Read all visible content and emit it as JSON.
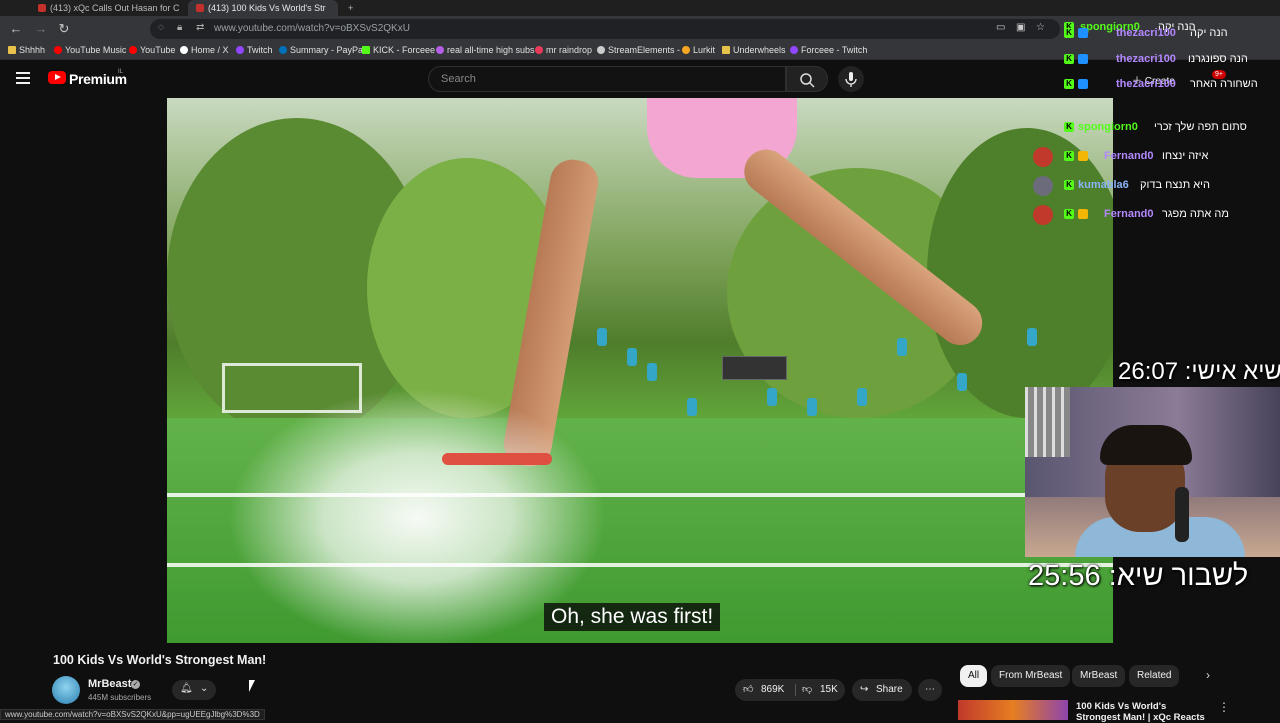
{
  "browser": {
    "tabs": [
      {
        "label": "(413) xQc Calls Out Hasan for C"
      },
      {
        "label": "(413) 100 Kids Vs World's Str"
      }
    ],
    "url": "www.youtube.com/watch?v=oBXSvS2QKxU",
    "status_url": "www.youtube.com/watch?v=oBXSvS2QKxU&pp=ugUEEgJlbg%3D%3D",
    "bookmarks": [
      "Shhhh",
      "YouTube Music",
      "YouTube",
      "Home / X",
      "Twitch",
      "Summary - PayPal",
      "KICK - Forceee",
      "real all-time high subs",
      "mr raindrop",
      "StreamElements -",
      "Lurkit",
      "Underwheels",
      "Forceee - Twitch"
    ]
  },
  "youtube": {
    "brand": "Premium",
    "brand_country": "IL",
    "search_placeholder": "Search",
    "create_label": "Create",
    "notification_count": "9+",
    "video": {
      "caption": "Oh, she was first!",
      "title": "100 Kids Vs World's Strongest Man!"
    },
    "channel": {
      "name": "MrBeast",
      "subscribers": "445M subscribers"
    },
    "actions": {
      "likes": "869K",
      "dislikes": "15K",
      "share": "Share"
    },
    "chips": [
      "All",
      "From MrBeast",
      "MrBeast",
      "Related"
    ],
    "recommendation": {
      "title": "100 Kids Vs World's Strongest Man! | xQc Reacts"
    }
  },
  "stream_overlay": {
    "chat": [
      {
        "user": "spongiorn0",
        "message": "הנה יקה"
      },
      {
        "user": "thezacri100",
        "message": "הנה יקה"
      },
      {
        "user": "thezacri100",
        "message": "הנה ספונגרנו"
      },
      {
        "user": "thezacri100",
        "message": "השחורה האחר"
      },
      {
        "user": "spongiorn0",
        "message": "סתום תפה שלך זכרי"
      },
      {
        "user": "Fernand0",
        "message": "איזה ינצחו"
      },
      {
        "user": "kumabla6",
        "message": "היא תנצח בדוק"
      },
      {
        "user": "Fernand0",
        "message": "מה אתה מפגר"
      }
    ],
    "timer_personal": "שיא אישי: 26:07",
    "timer_record": "לשבור שיא: 25:56"
  },
  "colors": {
    "accent": "#ff0000",
    "kick_green": "#53fc18",
    "username_purple": "#b388ff"
  }
}
